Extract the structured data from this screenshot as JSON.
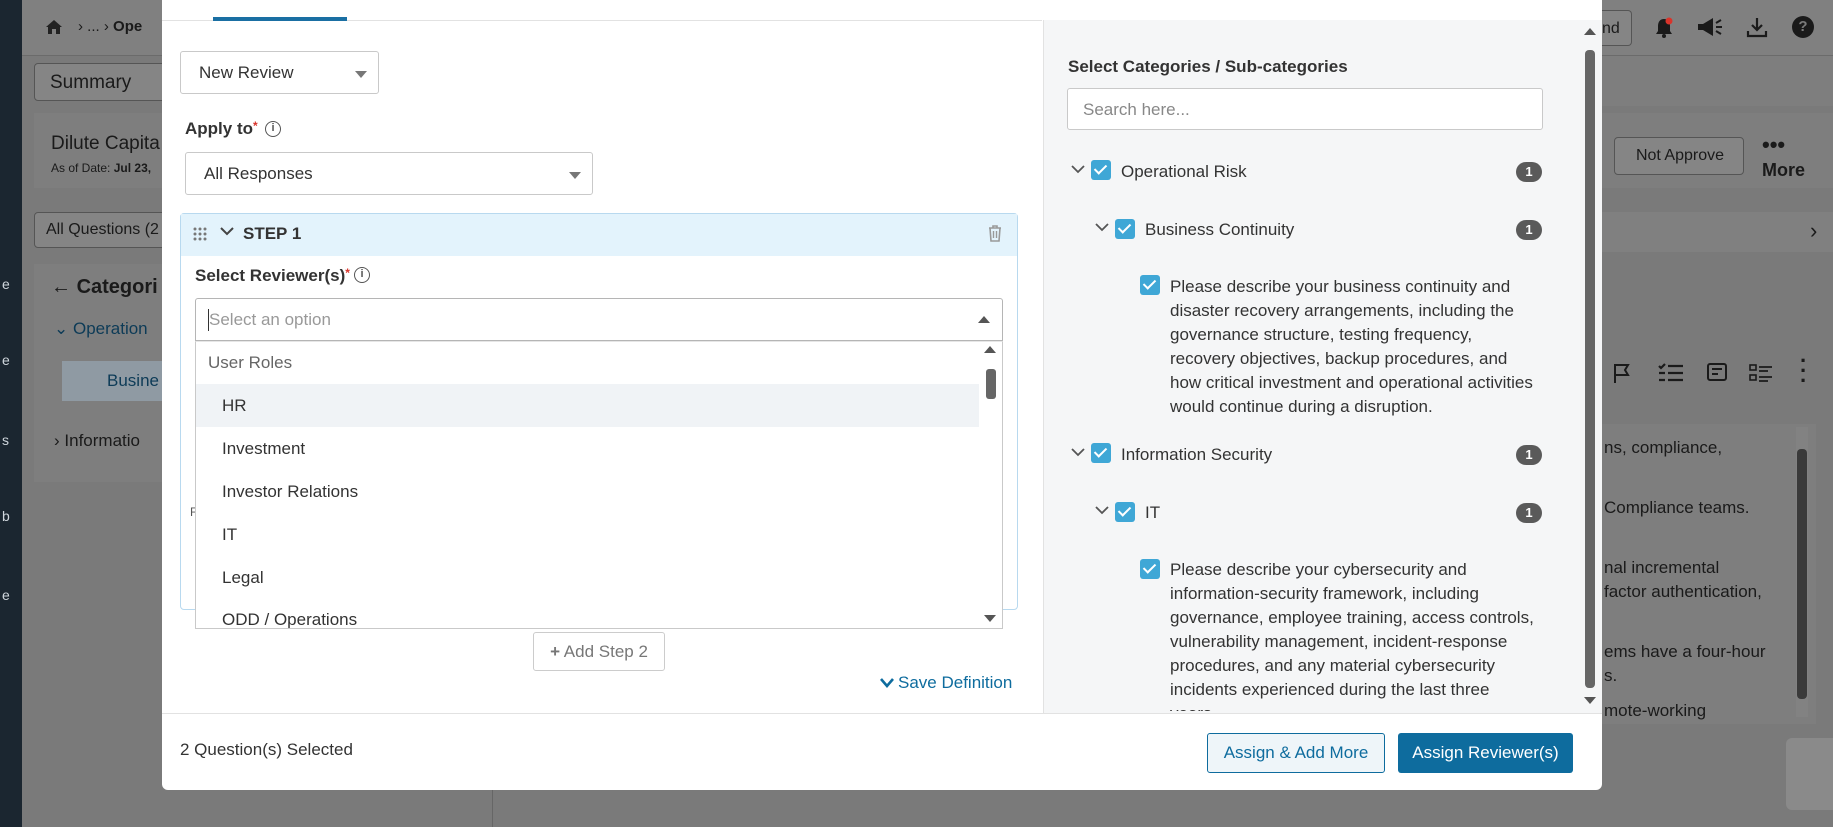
{
  "background": {
    "breadcrumb_tail": "Ope",
    "breadcrumb_dots": "...",
    "summary_tab": "Summary",
    "fund_name": "Dilute Capita",
    "as_of_label": "As of Date:",
    "as_of_value": "Jul 23,",
    "all_questions": "All Questions (2",
    "categories_title": "Categori",
    "cat_operational": "Operation",
    "cat_business": "Busine",
    "cat_information": "Informatio",
    "top_right_button": "nd",
    "not_approve": "Not Approve",
    "more_label": "More",
    "text_lines": [
      "ns, compliance,",
      "Compliance teams.",
      "nal incremental",
      "factor authentication,",
      "ems have a four-hour",
      "s.",
      "mote-working"
    ],
    "left_letters": [
      "e",
      "e",
      "s",
      "b",
      "e"
    ]
  },
  "modal": {
    "review_select": "New Review",
    "apply_to_label": "Apply to",
    "apply_to_value": "All Responses",
    "step_title": "STEP 1",
    "select_reviewers_label": "Select Reviewer(s)",
    "reviewer_placeholder": "Select an option",
    "dropdown_group": "User Roles",
    "dropdown_options": [
      "HR",
      "Investment",
      "Investor Relations",
      "IT",
      "Legal",
      "ODD / Operations"
    ],
    "add_step": "Add Step 2",
    "save_definition": "Save Definition",
    "hidden_letter": "F",
    "selected_count": "2 Question(s) Selected",
    "assign_add_more": "Assign & Add More",
    "assign_reviewers": "Assign Reviewer(s)"
  },
  "categories_panel": {
    "title": "Select Categories / Sub-categories",
    "search_placeholder": "Search here...",
    "operational_risk": "Operational Risk",
    "operational_risk_count": "1",
    "business_continuity": "Business Continuity",
    "business_continuity_count": "1",
    "bc_question": "Please describe your business continuity and disaster recovery arrangements, including the governance structure, testing frequency, recovery objectives, backup procedures, and how critical investment and operational activities would continue during a disruption.",
    "information_security": "Information Security",
    "information_security_count": "1",
    "it": "IT",
    "it_count": "1",
    "it_question": "Please describe your cybersecurity and information-security framework, including governance, employee training, access controls, vulnerability management, incident-response procedures, and any material cybersecurity incidents experienced during the last three years."
  },
  "colors": {
    "primary": "#0e6c9e",
    "checkbox": "#3fa7d6",
    "step_header": "#e3f3fc",
    "required": "#d9342b"
  }
}
